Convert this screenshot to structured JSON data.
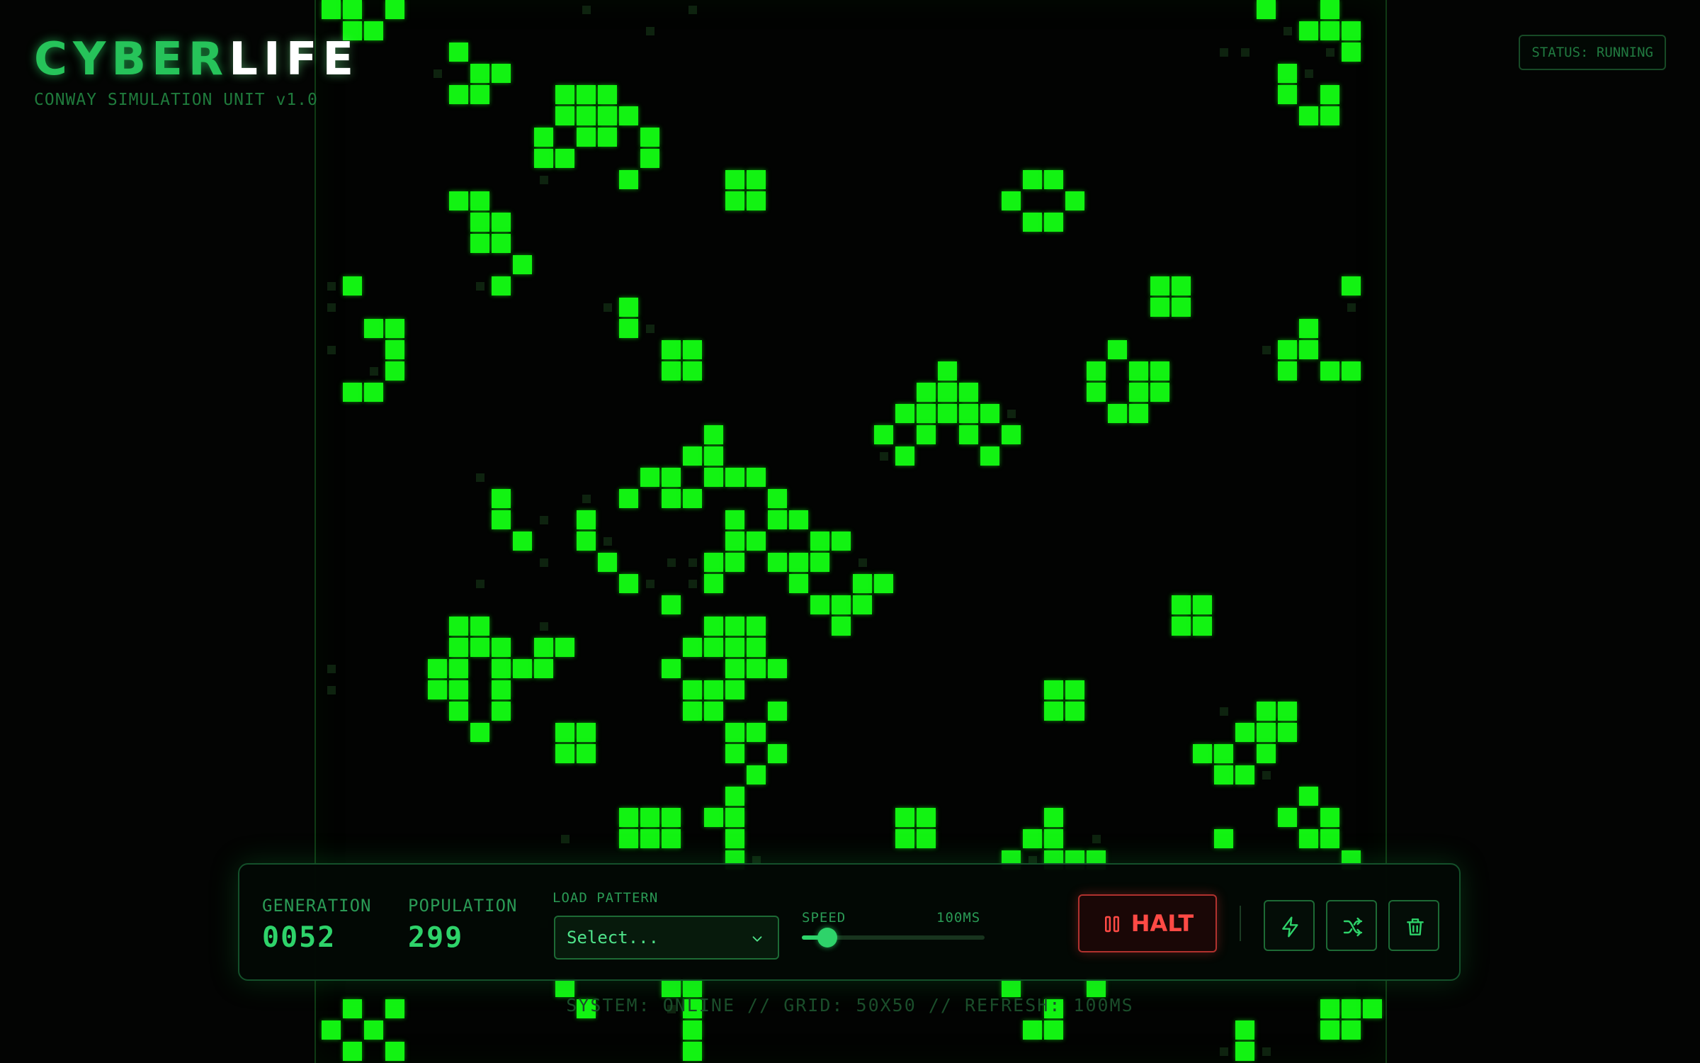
{
  "header": {
    "logo_part1": "CYBER",
    "logo_part2": "LIFE",
    "subtitle": "CONWAY SIMULATION UNIT v1.0",
    "status": "STATUS: RUNNING"
  },
  "controls": {
    "generation_label": "GENERATION",
    "generation_value": "0052",
    "population_label": "POPULATION",
    "population_value": "299",
    "load_pattern_label": "LOAD PATTERN",
    "select_value": "Select...",
    "speed_label": "SPEED",
    "speed_value": "100MS",
    "speed_fraction": 0.14,
    "halt_label": "HALT"
  },
  "footer": "SYSTEM: ONLINE // GRID: 50X50 // REFRESH: 100MS",
  "colors": {
    "accent": "#2ed36a",
    "cell": "#12f312",
    "halt": "#ff4a45",
    "background": "#030403"
  },
  "icons": {
    "halt": "pause-icon",
    "step": "lightning-icon",
    "randomize": "shuffle-icon",
    "clear": "trash-icon",
    "dropdown": "chevron-down-icon"
  },
  "grid": {
    "columns": 50,
    "rows": 50,
    "live_cells": [
      [
        0,
        0
      ],
      [
        1,
        0
      ],
      [
        3,
        0
      ],
      [
        1,
        1
      ],
      [
        2,
        1
      ],
      [
        6,
        2
      ],
      [
        7,
        3
      ],
      [
        8,
        3
      ],
      [
        6,
        4
      ],
      [
        7,
        4
      ],
      [
        11,
        4
      ],
      [
        12,
        4
      ],
      [
        13,
        4
      ],
      [
        11,
        5
      ],
      [
        12,
        5
      ],
      [
        13,
        5
      ],
      [
        14,
        5
      ],
      [
        10,
        6
      ],
      [
        12,
        6
      ],
      [
        13,
        6
      ],
      [
        15,
        6
      ],
      [
        10,
        7
      ],
      [
        11,
        7
      ],
      [
        15,
        7
      ],
      [
        14,
        8
      ],
      [
        19,
        8
      ],
      [
        20,
        8
      ],
      [
        19,
        9
      ],
      [
        20,
        9
      ],
      [
        6,
        9
      ],
      [
        7,
        9
      ],
      [
        7,
        10
      ],
      [
        8,
        10
      ],
      [
        7,
        11
      ],
      [
        8,
        11
      ],
      [
        9,
        12
      ],
      [
        8,
        13
      ],
      [
        1,
        13
      ],
      [
        2,
        15
      ],
      [
        3,
        15
      ],
      [
        3,
        16
      ],
      [
        3,
        17
      ],
      [
        1,
        18
      ],
      [
        2,
        18
      ],
      [
        14,
        14
      ],
      [
        14,
        15
      ],
      [
        16,
        16
      ],
      [
        17,
        16
      ],
      [
        16,
        17
      ],
      [
        17,
        17
      ],
      [
        33,
        8
      ],
      [
        34,
        8
      ],
      [
        32,
        9
      ],
      [
        35,
        9
      ],
      [
        33,
        10
      ],
      [
        34,
        10
      ],
      [
        39,
        13
      ],
      [
        40,
        13
      ],
      [
        39,
        14
      ],
      [
        40,
        14
      ],
      [
        44,
        0
      ],
      [
        47,
        0
      ],
      [
        46,
        1
      ],
      [
        47,
        1
      ],
      [
        48,
        1
      ],
      [
        48,
        2
      ],
      [
        45,
        3
      ],
      [
        45,
        4
      ],
      [
        47,
        4
      ],
      [
        46,
        5
      ],
      [
        47,
        5
      ],
      [
        48,
        13
      ],
      [
        46,
        15
      ],
      [
        45,
        16
      ],
      [
        46,
        16
      ],
      [
        45,
        17
      ],
      [
        47,
        17
      ],
      [
        48,
        17
      ],
      [
        37,
        16
      ],
      [
        36,
        17
      ],
      [
        38,
        17
      ],
      [
        39,
        17
      ],
      [
        36,
        18
      ],
      [
        38,
        18
      ],
      [
        39,
        18
      ],
      [
        37,
        19
      ],
      [
        38,
        19
      ],
      [
        29,
        17
      ],
      [
        28,
        18
      ],
      [
        29,
        18
      ],
      [
        30,
        18
      ],
      [
        27,
        19
      ],
      [
        28,
        19
      ],
      [
        29,
        19
      ],
      [
        30,
        19
      ],
      [
        31,
        19
      ],
      [
        26,
        20
      ],
      [
        28,
        20
      ],
      [
        30,
        20
      ],
      [
        32,
        20
      ],
      [
        27,
        21
      ],
      [
        31,
        21
      ],
      [
        18,
        20
      ],
      [
        17,
        21
      ],
      [
        18,
        21
      ],
      [
        15,
        22
      ],
      [
        16,
        22
      ],
      [
        18,
        22
      ],
      [
        19,
        22
      ],
      [
        20,
        22
      ],
      [
        14,
        23
      ],
      [
        16,
        23
      ],
      [
        17,
        23
      ],
      [
        21,
        23
      ],
      [
        8,
        23
      ],
      [
        8,
        24
      ],
      [
        9,
        25
      ],
      [
        12,
        24
      ],
      [
        19,
        24
      ],
      [
        21,
        24
      ],
      [
        22,
        24
      ],
      [
        12,
        25
      ],
      [
        19,
        25
      ],
      [
        20,
        25
      ],
      [
        23,
        25
      ],
      [
        24,
        25
      ],
      [
        13,
        26
      ],
      [
        18,
        26
      ],
      [
        19,
        26
      ],
      [
        21,
        26
      ],
      [
        22,
        26
      ],
      [
        23,
        26
      ],
      [
        14,
        27
      ],
      [
        18,
        27
      ],
      [
        22,
        27
      ],
      [
        25,
        27
      ],
      [
        26,
        27
      ],
      [
        16,
        28
      ],
      [
        23,
        28
      ],
      [
        24,
        28
      ],
      [
        25,
        28
      ],
      [
        24,
        29
      ],
      [
        6,
        29
      ],
      [
        7,
        29
      ],
      [
        6,
        30
      ],
      [
        7,
        30
      ],
      [
        8,
        30
      ],
      [
        10,
        30
      ],
      [
        11,
        30
      ],
      [
        5,
        31
      ],
      [
        6,
        31
      ],
      [
        8,
        31
      ],
      [
        9,
        31
      ],
      [
        10,
        31
      ],
      [
        5,
        32
      ],
      [
        6,
        32
      ],
      [
        8,
        32
      ],
      [
        6,
        33
      ],
      [
        8,
        33
      ],
      [
        7,
        34
      ],
      [
        18,
        29
      ],
      [
        19,
        29
      ],
      [
        20,
        29
      ],
      [
        17,
        30
      ],
      [
        18,
        30
      ],
      [
        19,
        30
      ],
      [
        20,
        30
      ],
      [
        16,
        31
      ],
      [
        19,
        31
      ],
      [
        20,
        31
      ],
      [
        21,
        31
      ],
      [
        17,
        32
      ],
      [
        18,
        32
      ],
      [
        19,
        32
      ],
      [
        17,
        33
      ],
      [
        18,
        33
      ],
      [
        21,
        33
      ],
      [
        19,
        34
      ],
      [
        20,
        34
      ],
      [
        19,
        35
      ],
      [
        21,
        35
      ],
      [
        20,
        36
      ],
      [
        19,
        37
      ],
      [
        18,
        38
      ],
      [
        19,
        38
      ],
      [
        19,
        39
      ],
      [
        11,
        34
      ],
      [
        12,
        34
      ],
      [
        11,
        35
      ],
      [
        12,
        35
      ],
      [
        40,
        28
      ],
      [
        41,
        28
      ],
      [
        40,
        29
      ],
      [
        41,
        29
      ],
      [
        34,
        32
      ],
      [
        35,
        32
      ],
      [
        34,
        33
      ],
      [
        35,
        33
      ],
      [
        44,
        33
      ],
      [
        45,
        33
      ],
      [
        43,
        34
      ],
      [
        44,
        34
      ],
      [
        45,
        34
      ],
      [
        41,
        35
      ],
      [
        42,
        35
      ],
      [
        44,
        35
      ],
      [
        42,
        36
      ],
      [
        43,
        36
      ],
      [
        46,
        37
      ],
      [
        45,
        38
      ],
      [
        47,
        38
      ],
      [
        42,
        39
      ],
      [
        46,
        39
      ],
      [
        47,
        39
      ],
      [
        14,
        38
      ],
      [
        15,
        38
      ],
      [
        16,
        38
      ],
      [
        14,
        39
      ],
      [
        15,
        39
      ],
      [
        16,
        39
      ],
      [
        27,
        38
      ],
      [
        28,
        38
      ],
      [
        27,
        39
      ],
      [
        28,
        39
      ],
      [
        34,
        38
      ],
      [
        33,
        39
      ],
      [
        34,
        39
      ],
      [
        32,
        40
      ],
      [
        34,
        40
      ],
      [
        35,
        40
      ],
      [
        36,
        40
      ],
      [
        19,
        40
      ],
      [
        48,
        40
      ],
      [
        47,
        38
      ],
      [
        11,
        46
      ],
      [
        16,
        46
      ],
      [
        17,
        46
      ],
      [
        1,
        47
      ],
      [
        3,
        47
      ],
      [
        0,
        48
      ],
      [
        2,
        48
      ],
      [
        1,
        49
      ],
      [
        3,
        49
      ],
      [
        32,
        46
      ],
      [
        36,
        46
      ],
      [
        34,
        47
      ],
      [
        33,
        48
      ],
      [
        34,
        48
      ],
      [
        47,
        47
      ],
      [
        48,
        47
      ],
      [
        49,
        47
      ],
      [
        47,
        48
      ],
      [
        48,
        48
      ],
      [
        43,
        48
      ],
      [
        43,
        49
      ],
      [
        17,
        47
      ],
      [
        17,
        48
      ],
      [
        17,
        49
      ],
      [
        12,
        47
      ]
    ],
    "ghost_cells": [
      [
        12,
        0
      ],
      [
        15,
        1
      ],
      [
        17,
        0
      ],
      [
        5,
        3
      ],
      [
        10,
        8
      ],
      [
        7,
        13
      ],
      [
        0,
        13
      ],
      [
        0,
        14
      ],
      [
        0,
        16
      ],
      [
        2,
        17
      ],
      [
        13,
        14
      ],
      [
        15,
        15
      ],
      [
        45,
        1
      ],
      [
        43,
        2
      ],
      [
        47,
        2
      ],
      [
        46,
        3
      ],
      [
        42,
        2
      ],
      [
        48,
        14
      ],
      [
        44,
        16
      ],
      [
        7,
        22
      ],
      [
        10,
        24
      ],
      [
        12,
        23
      ],
      [
        13,
        25
      ],
      [
        16,
        26
      ],
      [
        17,
        26
      ],
      [
        10,
        26
      ],
      [
        7,
        27
      ],
      [
        15,
        27
      ],
      [
        17,
        27
      ],
      [
        25,
        26
      ],
      [
        0,
        31
      ],
      [
        0,
        32
      ],
      [
        10,
        29
      ],
      [
        26,
        21
      ],
      [
        32,
        19
      ],
      [
        43,
        34
      ],
      [
        44,
        36
      ],
      [
        11,
        39
      ],
      [
        33,
        40
      ],
      [
        36,
        39
      ],
      [
        42,
        33
      ],
      [
        10,
        43
      ],
      [
        20,
        40
      ],
      [
        44,
        49
      ],
      [
        42,
        49
      ],
      [
        16,
        47
      ]
    ]
  }
}
